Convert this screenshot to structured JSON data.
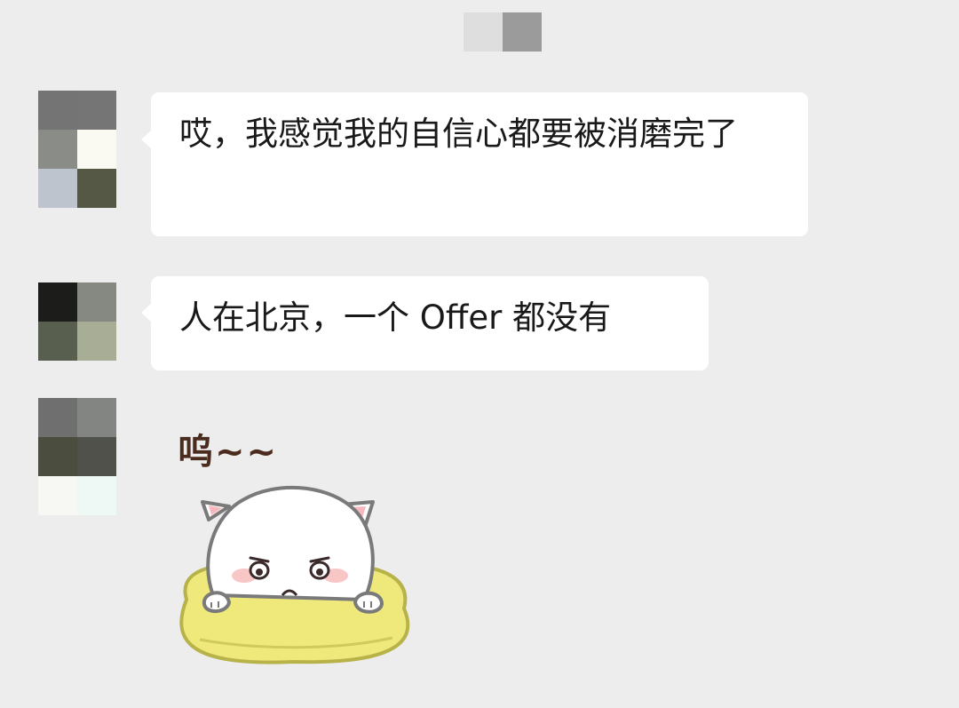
{
  "header": {
    "blurred_title_colors": [
      "#dedede",
      "#9b9b9b"
    ]
  },
  "messages": [
    {
      "avatar_colors": [
        "#747474",
        "#757575",
        "#8a8c87",
        "#fafaf2",
        "#bec4ce",
        "#545845"
      ],
      "text": "哎，我感觉我的自信心都要被消磨完了"
    },
    {
      "avatar_colors": [
        "#1c1c1a",
        "#858981",
        "#585f4f",
        "#a8ae96"
      ],
      "text": "人在北京，一个 Offer 都没有"
    },
    {
      "avatar_colors": [
        "#6f6f70",
        "#838582",
        "#4b4e3f",
        "#50514a",
        "#f7f7f4",
        "#eef8f4"
      ],
      "sticker": {
        "caption": "呜~~",
        "icon": "crying-cat-on-pillow-sticker"
      }
    }
  ]
}
